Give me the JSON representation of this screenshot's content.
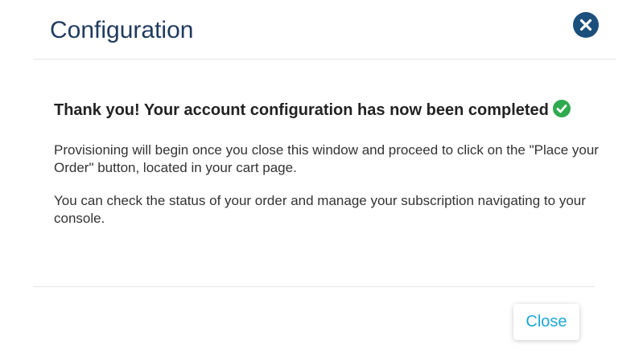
{
  "dialog": {
    "title": "Configuration",
    "close_icon": "close-circle-icon",
    "headline": "Thank you! Your account configuration has now been completed",
    "headline_icon": "check-circle-icon",
    "paragraphs": [
      "Provisioning will begin once you close this window and proceed to click on the \"Place your Order\" button, located in your cart page.",
      "You can check the status of your order and manage your subscription navigating to your console."
    ],
    "close_button_label": "Close"
  },
  "colors": {
    "title": "#1f3a5f",
    "close_icon_bg": "#1b4f7c",
    "success_green": "#2eaa4e",
    "button_text": "#1aa8d6",
    "divider": "#e6e6e6"
  }
}
